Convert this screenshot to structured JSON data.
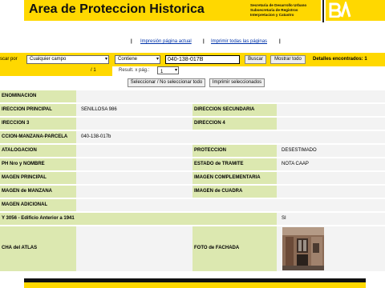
{
  "header": {
    "title": "Area de Proteccion Historica",
    "org_lines": [
      "Secretaria de Desarrollo Urbano",
      "Subsecretaria de Registros",
      "Interpretacion y Catastro"
    ],
    "logo_text": "BA",
    "colors": {
      "brand_yellow": "#ffd800",
      "label_green": "#dce8b0"
    }
  },
  "links": {
    "print_current": "Impresión página actual",
    "print_all": "Imprimir todas las páginas",
    "pipe": "|"
  },
  "search": {
    "label": "scar por",
    "field_select": "Cualquier campo",
    "operator_select": "Contiene",
    "query_value": "040-138-017B",
    "search_button": "Buscar",
    "show_all_button": "Mostrar todo",
    "found_text": "Detalles encontrados: 1"
  },
  "pager": {
    "page_of": "/ 1",
    "results_per_page_label": "Result. x pág.:",
    "results_per_page_value": "1"
  },
  "actions": {
    "select_toggle": "Seleccionar / No seleccionar todo",
    "print_selected": "Imprimir seleccionados"
  },
  "record": {
    "denominacion_label": "ENOMINACION",
    "denominacion_value": "",
    "dir_principal_label": "IRECCION PRINCIPAL",
    "dir_principal_value": "SENILLOSA 986",
    "dir_secundaria_label": "DIRECCION SECUNDARIA",
    "dir_secundaria_value": "",
    "dir3_label": "IRECCION 3",
    "dir3_value": "",
    "dir4_label": "DIRECCION 4",
    "dir4_value": "",
    "smp_label": "CCION-MANZANA-PARCELA",
    "smp_value": "040-138-017b",
    "catalogacion_label": "ATALOGACION",
    "catalogacion_value": "",
    "proteccion_label": "PROTECCION",
    "proteccion_value": "DESESTIMADO",
    "ph_label": "PH Nro y NOMBRE",
    "ph_value": "",
    "estado_label": "ESTADO de TRAMITE",
    "estado_value": "NOTA CAAP",
    "img_principal_label": "MAGEN PRINCIPAL",
    "img_principal_value": "",
    "img_complementaria_label": "IMAGEN COMPLEMENTARIA",
    "img_complementaria_value": "",
    "img_manzana_label": "MAGEN de MANZANA",
    "img_manzana_value": "",
    "img_cuadra_label": "IMAGEN de CUADRA",
    "img_cuadra_value": "",
    "img_adicional_label": "MAGEN ADICIONAL",
    "img_adicional_value": "",
    "ley_label": "Y 3056 - Edificio Anterior a 1941",
    "ley_value": "SI",
    "ficha_label": "CHA del ATLAS",
    "ficha_value": "",
    "foto_label": "FOTO de FACHADA"
  }
}
